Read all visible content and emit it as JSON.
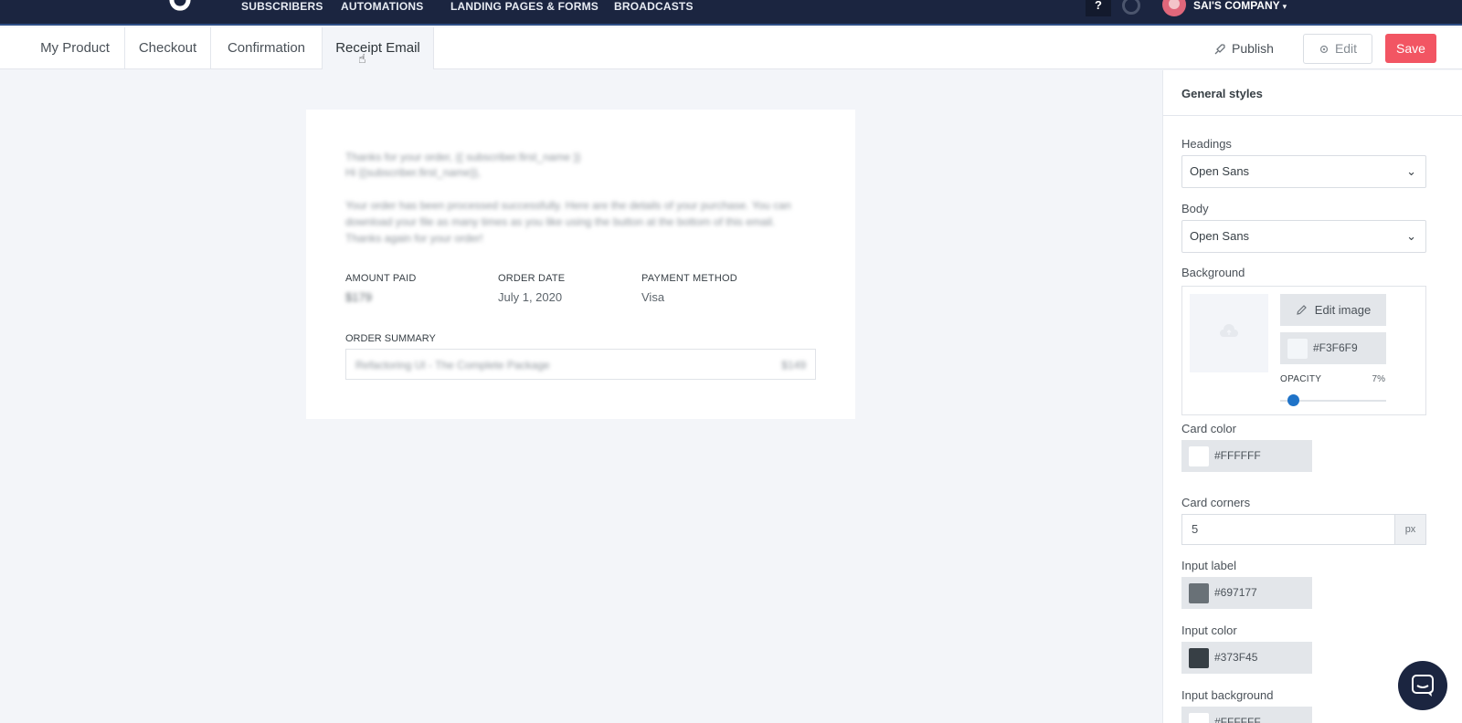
{
  "topnav": {
    "items": [
      "SUBSCRIBERS",
      "AUTOMATIONS",
      "LANDING PAGES & FORMS",
      "BROADCASTS"
    ],
    "help": "?",
    "company": "SAI'S COMPANY"
  },
  "tabs": [
    "My Product",
    "Checkout",
    "Confirmation",
    "Receipt Email"
  ],
  "actions": {
    "publish": "Publish",
    "edit": "Edit",
    "save": "Save"
  },
  "email": {
    "intro_line1": "Thanks for your order, {{ subscriber.first_name }}",
    "intro_line2": "Hi {{subscriber.first_name}},",
    "intro_body": "Your order has been processed successfully. Here are the details of your purchase. You can download your file as many times as you like using the button at the bottom of this email. Thanks again for your order!",
    "amount_paid_label": "AMOUNT PAID",
    "amount_paid_value": "$179",
    "order_date_label": "ORDER DATE",
    "order_date_value": "July 1, 2020",
    "payment_method_label": "PAYMENT METHOD",
    "payment_method_value": "Visa",
    "order_summary_label": "ORDER SUMMARY",
    "item_name": "Refactoring UI - The Complete Package",
    "item_price": "$149"
  },
  "panel": {
    "title": "General styles",
    "headings_label": "Headings",
    "headings_value": "Open Sans",
    "body_label": "Body",
    "body_value": "Open Sans",
    "background_label": "Background",
    "edit_image": "Edit image",
    "background_color": "#F3F6F9",
    "opacity_label": "OPACITY",
    "opacity_value": "7%",
    "card_color_label": "Card color",
    "card_color": "#FFFFFF",
    "card_corners_label": "Card corners",
    "card_corners_value": "5",
    "card_corners_unit": "px",
    "input_label_label": "Input label",
    "input_label_color": "#697177",
    "input_color_label": "Input color",
    "input_color": "#373F45",
    "input_background_label": "Input background",
    "input_background_color": "#FFFFFF"
  }
}
